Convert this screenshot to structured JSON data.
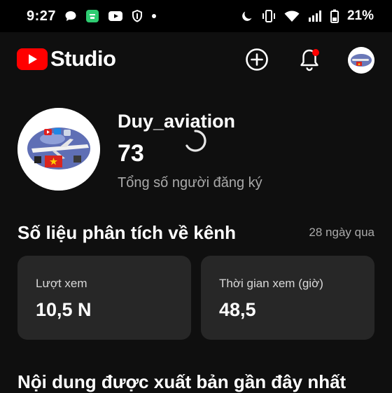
{
  "status_bar": {
    "time": "9:27",
    "battery_pct": "21%",
    "left_icons": [
      "chat-bubble-icon",
      "notification-app-icon",
      "youtube-icon",
      "shield-icon",
      "dot-icon"
    ],
    "right_icons": [
      "moon-icon",
      "vibrate-icon",
      "wifi-icon",
      "signal-icon",
      "battery-icon"
    ]
  },
  "app_bar": {
    "logo_text": "Studio",
    "brand_color": "#ff0000"
  },
  "channel": {
    "name": "Duy_aviation",
    "subscriber_count": "73",
    "subscriber_label": "Tổng số người đăng ký"
  },
  "analytics": {
    "title": "Số liệu phân tích về kênh",
    "period": "28 ngày qua",
    "cards": [
      {
        "label": "Lượt xem",
        "value": "10,5 N"
      },
      {
        "label": "Thời gian xem (giờ)",
        "value": "48,5"
      }
    ]
  },
  "recent": {
    "title": "Nội dung được xuất bản gần đây nhất"
  }
}
